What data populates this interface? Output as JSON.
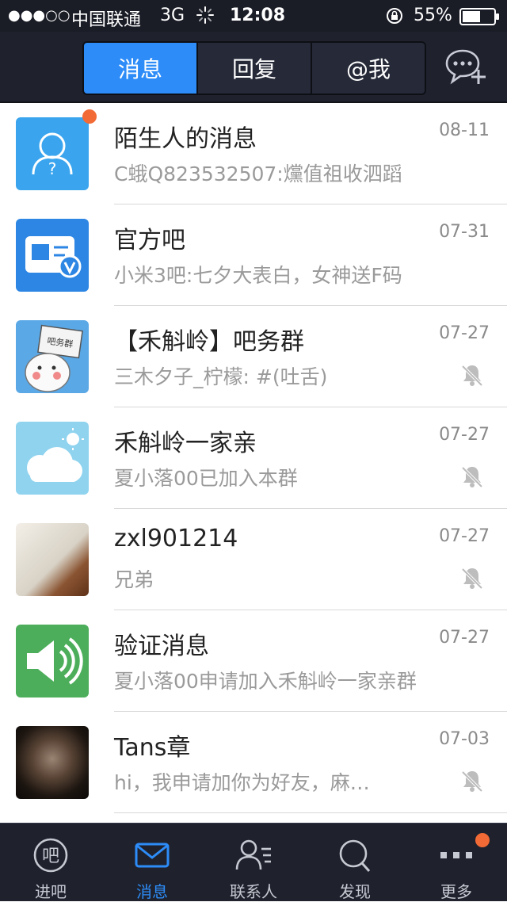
{
  "status_bar": {
    "signal": "●●●○○",
    "carrier": "中国联通",
    "network": "3G",
    "time": "12:08",
    "battery": "55%"
  },
  "nav": {
    "tabs": [
      {
        "label": "消息",
        "active": true
      },
      {
        "label": "回复",
        "active": false
      },
      {
        "label": "@我",
        "active": false
      }
    ],
    "new_chat_icon": "chat-add-icon"
  },
  "conversations": [
    {
      "name": "陌生人的消息",
      "preview": "C蛾Q823532507:爣值祖收泗蹈",
      "date": "08-11",
      "muted": false,
      "unread": true,
      "avatar": "stranger-icon"
    },
    {
      "name": "官方吧",
      "preview": "小米3吧:七夕大表白，女神送F码",
      "date": "07-31",
      "muted": false,
      "unread": false,
      "avatar": "official-bar-icon"
    },
    {
      "name": "【禾斛岭】吧务群",
      "preview": "三木夕子_柠檬: #(吐舌)",
      "date": "07-27",
      "muted": true,
      "unread": false,
      "avatar": "group-cartoon-avatar"
    },
    {
      "name": "禾斛岭一家亲",
      "preview": "夏小落00已加入本群",
      "date": "07-27",
      "muted": true,
      "unread": false,
      "avatar": "cloud-sun-avatar"
    },
    {
      "name": "zxl901214",
      "preview": "兄弟",
      "date": "07-27",
      "muted": true,
      "unread": false,
      "avatar": "photo-avatar"
    },
    {
      "name": "验证消息",
      "preview": "夏小落00申请加入禾斛岭一家亲群",
      "date": "07-27",
      "muted": false,
      "unread": false,
      "avatar": "speaker-icon"
    },
    {
      "name": "Tans章",
      "preview": "hi，我申请加你为好友，麻…",
      "date": "07-03",
      "muted": true,
      "unread": false,
      "avatar": "photo-avatar-dark"
    }
  ],
  "tab_bar": [
    {
      "label": "进吧",
      "icon": "bar-icon",
      "active": false
    },
    {
      "label": "消息",
      "icon": "mail-icon",
      "active": true
    },
    {
      "label": "联系人",
      "icon": "contacts-icon",
      "active": false
    },
    {
      "label": "发现",
      "icon": "search-icon",
      "active": false
    },
    {
      "label": "更多",
      "icon": "more-icon",
      "active": false,
      "badge": true
    }
  ],
  "colors": {
    "accent": "#2d8cf8",
    "bar_bg": "#1f222d",
    "badge": "#f26a35",
    "muted_text": "#9a9a9a"
  }
}
